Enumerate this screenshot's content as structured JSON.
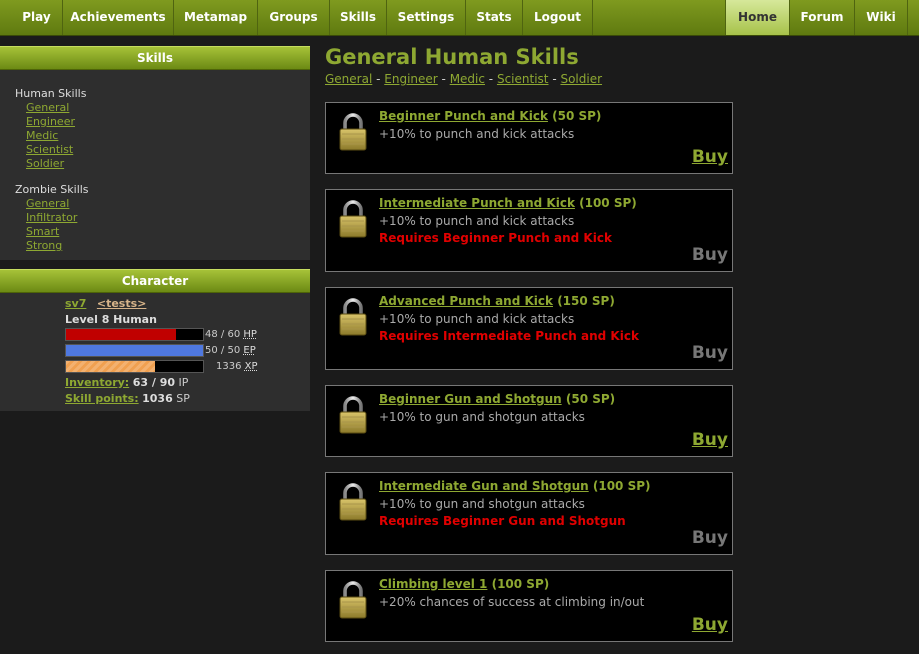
{
  "nav": {
    "left": [
      "Play",
      "Achievements",
      "Metamap",
      "Groups",
      "Skills",
      "Settings",
      "Stats",
      "Logout"
    ],
    "right": [
      "Home",
      "Forum",
      "Wiki"
    ]
  },
  "skills_panel": {
    "header": "Skills",
    "human_group": "Human Skills",
    "human_items": [
      "General",
      "Engineer",
      "Medic",
      "Scientist",
      "Soldier"
    ],
    "zombie_group": "Zombie Skills",
    "zombie_items": [
      "General",
      "Infiltrator",
      "Smart",
      "Strong"
    ]
  },
  "character_panel": {
    "header": "Character",
    "name": "sv7",
    "group_tag": "<tests>",
    "level": "Level 8 Human",
    "hp": {
      "text": "48 / 60",
      "unit": "HP",
      "value": 48,
      "max": 60,
      "color": "#c00000"
    },
    "ep": {
      "text": "50 / 50",
      "unit": "EP",
      "value": 50,
      "max": 50,
      "color": "#4f78e0"
    },
    "xp": {
      "text": "1336",
      "unit": "XP",
      "fraction": 0.65,
      "color": "#f0a050"
    },
    "inventory_label": "Inventory:",
    "inventory_value": "63 / 90",
    "inventory_unit": "IP",
    "skillpoints_label": "Skill points:",
    "skillpoints_value": "1036",
    "skillpoints_unit": "SP"
  },
  "main": {
    "title": "General Human Skills",
    "subnav": [
      "General",
      "Engineer",
      "Medic",
      "Scientist",
      "Soldier"
    ],
    "subnav_sep": " - ",
    "buy_label": "Buy",
    "skills": [
      {
        "name": "Beginner Punch and Kick",
        "cost": "(50 SP)",
        "desc": "+10% to punch and kick attacks",
        "req": "",
        "available": true
      },
      {
        "name": "Intermediate Punch and Kick",
        "cost": "(100 SP)",
        "desc": "+10% to punch and kick attacks",
        "req": "Requires Beginner Punch and Kick",
        "available": false
      },
      {
        "name": "Advanced Punch and Kick",
        "cost": "(150 SP)",
        "desc": "+10% to punch and kick attacks",
        "req": "Requires Intermediate Punch and Kick",
        "available": false
      },
      {
        "name": "Beginner Gun and Shotgun",
        "cost": "(50 SP)",
        "desc": "+10% to gun and shotgun attacks",
        "req": "",
        "available": true
      },
      {
        "name": "Intermediate Gun and Shotgun",
        "cost": "(100 SP)",
        "desc": "+10% to gun and shotgun attacks",
        "req": "Requires Beginner Gun and Shotgun",
        "available": false
      },
      {
        "name": "Climbing level 1",
        "cost": "(100 SP)",
        "desc": "+20% chances of success at climbing in/out",
        "req": "",
        "available": true
      }
    ]
  },
  "icons": {
    "skill_lock": "padlock-icon"
  },
  "colors": {
    "accent": "#8ea832",
    "required": "#e00000",
    "disabled": "#777777"
  }
}
